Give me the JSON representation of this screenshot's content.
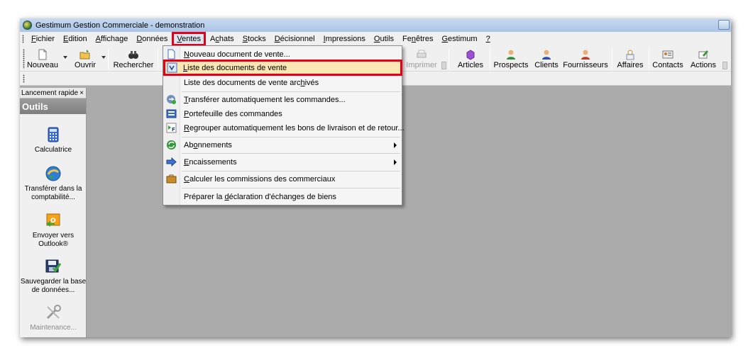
{
  "window": {
    "title": "Gestimum Gestion Commerciale - demonstration"
  },
  "menubar": {
    "items": [
      {
        "pre": "",
        "u": "F",
        "post": "ichier"
      },
      {
        "pre": "",
        "u": "E",
        "post": "dition"
      },
      {
        "pre": "",
        "u": "A",
        "post": "ffichage"
      },
      {
        "pre": "",
        "u": "D",
        "post": "onnées"
      },
      {
        "pre": "",
        "u": "V",
        "post": "entes"
      },
      {
        "pre": "A",
        "u": "c",
        "post": "hats"
      },
      {
        "pre": "",
        "u": "S",
        "post": "tocks"
      },
      {
        "pre": "",
        "u": "D",
        "post": "écisionnel"
      },
      {
        "pre": "",
        "u": "I",
        "post": "mpressions"
      },
      {
        "pre": "",
        "u": "O",
        "post": "utils"
      },
      {
        "pre": "Fe",
        "u": "n",
        "post": "êtres"
      },
      {
        "pre": "",
        "u": "G",
        "post": "estimum"
      },
      {
        "pre": "",
        "u": "?",
        "post": ""
      }
    ]
  },
  "toolbar": {
    "nouveau": "Nouveau",
    "ouvrir": "Ouvrir",
    "rechercher": "Rechercher",
    "imprimer": "Imprimer",
    "articles": "Articles",
    "prospects": "Prospects",
    "clients": "Clients",
    "fournisseurs": "Fournisseurs",
    "affaires": "Affaires",
    "contacts": "Contacts",
    "actions": "Actions"
  },
  "left_panel": {
    "tab": "Lancement rapide",
    "close": "×",
    "header": "Outils",
    "items": [
      {
        "line1": "Calculatrice",
        "line2": ""
      },
      {
        "line1": "Transférer dans la",
        "line2": "comptabilité..."
      },
      {
        "line1": "Envoyer vers",
        "line2": "Outlook®"
      },
      {
        "line1": "Sauvegarder la base",
        "line2": "de données..."
      },
      {
        "line1": "Maintenance...",
        "line2": ""
      }
    ]
  },
  "dropdown": {
    "items": [
      {
        "pre": "",
        "u": "N",
        "post": "ouveau document de vente..."
      },
      {
        "pre": "",
        "u": "L",
        "post": "iste des documents de vente"
      },
      {
        "pre": "Liste des documents de vente arc",
        "u": "h",
        "post": "ivés"
      },
      {
        "pre": "",
        "u": "T",
        "post": "ransférer automatiquement les commandes..."
      },
      {
        "pre": "",
        "u": "P",
        "post": "ortefeuille des commandes"
      },
      {
        "pre": "",
        "u": "R",
        "post": "egrouper automatiquement les bons de livraison et de retour..."
      },
      {
        "pre": "Ab",
        "u": "o",
        "post": "nnements"
      },
      {
        "pre": "",
        "u": "E",
        "post": "ncaissements"
      },
      {
        "pre": "",
        "u": "C",
        "post": "alculer les commissions des commerciaux"
      },
      {
        "pre": "Préparer la ",
        "u": "d",
        "post": "éclaration d'échanges de biens"
      }
    ]
  },
  "colors": {
    "highlight_border": "#e3001b",
    "highlight_fill": "#fbe7b4",
    "workspace": "#ababab"
  }
}
